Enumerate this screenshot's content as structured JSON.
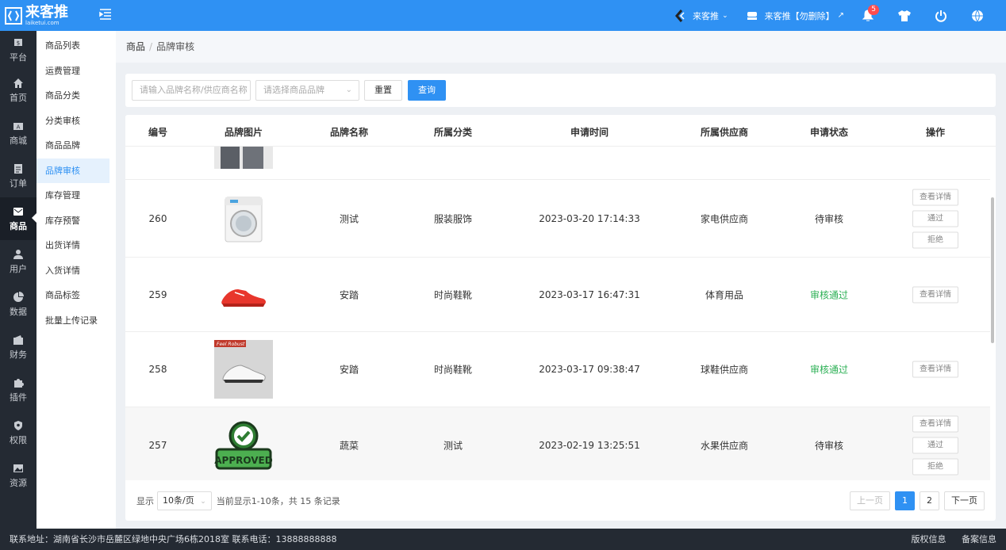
{
  "header": {
    "logo_cn": "来客推",
    "logo_en": "laiketui.com",
    "store_name": "来客推",
    "account_name": "来客推【勿删除】",
    "notification_count": "5"
  },
  "iconbar": [
    {
      "label": "平台",
      "icon": "dollar-icon"
    },
    {
      "label": "首页",
      "icon": "home-icon"
    },
    {
      "label": "商城",
      "icon": "store-icon"
    },
    {
      "label": "订单",
      "icon": "clipboard-icon"
    },
    {
      "label": "商品",
      "icon": "mail-icon"
    },
    {
      "label": "用户",
      "icon": "user-icon"
    },
    {
      "label": "数据",
      "icon": "pie-chart-icon"
    },
    {
      "label": "财务",
      "icon": "wallet-icon"
    },
    {
      "label": "插件",
      "icon": "puzzle-icon"
    },
    {
      "label": "权限",
      "icon": "shield-icon"
    },
    {
      "label": "资源",
      "icon": "image-icon"
    }
  ],
  "submenu": [
    "商品列表",
    "运费管理",
    "商品分类",
    "分类审核",
    "商品品牌",
    "品牌审核",
    "库存管理",
    "库存预警",
    "出货详情",
    "入货详情",
    "商品标签",
    "批量上传记录"
  ],
  "breadcrumb": {
    "root": "商品",
    "sep": "/",
    "current": "品牌审核"
  },
  "filter": {
    "keyword_placeholder": "请输入品牌名称/供应商名称",
    "brand_placeholder": "请选择商品品牌",
    "reset_label": "重置",
    "search_label": "查询"
  },
  "table": {
    "headers": [
      "编号",
      "品牌图片",
      "品牌名称",
      "所属分类",
      "申请时间",
      "所属供应商",
      "申请状态",
      "操作"
    ],
    "rows": [
      {
        "id": "260",
        "name": "测试",
        "category": "服装服饰",
        "time": "2023-03-20 17:14:33",
        "supplier": "家电供应商",
        "status": "待审核",
        "image": "washing-machine-image"
      },
      {
        "id": "259",
        "name": "安踏",
        "category": "时尚鞋靴",
        "time": "2023-03-17 16:47:31",
        "supplier": "体育用品",
        "status": "审核通过",
        "image": "red-sneaker-image"
      },
      {
        "id": "258",
        "name": "安踏",
        "category": "时尚鞋靴",
        "time": "2023-03-17 09:38:47",
        "supplier": "球鞋供应商",
        "status": "审核通过",
        "image": "white-sneaker-image"
      },
      {
        "id": "257",
        "name": "蔬菜",
        "category": "测试",
        "time": "2023-02-19 13:25:51",
        "supplier": "水果供应商",
        "status": "待审核",
        "image": "approved-badge-image"
      }
    ],
    "op_view": "查看详情",
    "op_pass": "通过",
    "op_reject": "拒绝",
    "sneaker_tag": "Feel Robust"
  },
  "approved_text": "APPROVED",
  "pager": {
    "show_label": "显示",
    "page_size": "10条/页",
    "summary": "当前显示1-10条，共 15 条记录",
    "prev": "上一页",
    "pages": [
      "1",
      "2"
    ],
    "next": "下一页"
  },
  "footer": {
    "address": "联系地址：湖南省长沙市岳麓区绿地中央广场6栋2018室 联系电话：13888888888",
    "copyright": "版权信息",
    "icp": "备案信息"
  },
  "colors": {
    "primary": "#2f91f3",
    "success": "#2cb055",
    "sidebar": "#242a33"
  }
}
